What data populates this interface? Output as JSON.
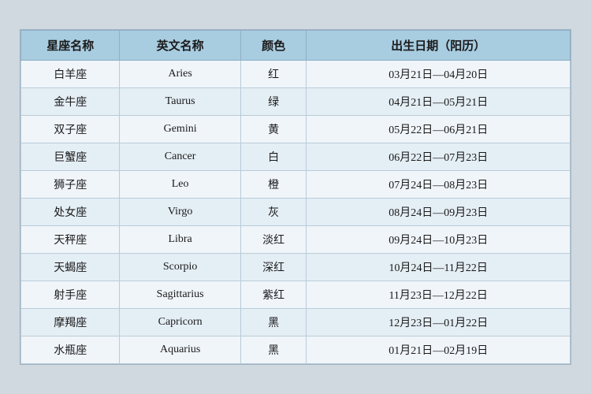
{
  "table": {
    "headers": [
      "星座名称",
      "英文名称",
      "颜色",
      "出生日期（阳历）"
    ],
    "rows": [
      {
        "zh": "白羊座",
        "en": "Aries",
        "color": "红",
        "date": "03月21日—04月20日"
      },
      {
        "zh": "金牛座",
        "en": "Taurus",
        "color": "绿",
        "date": "04月21日—05月21日"
      },
      {
        "zh": "双子座",
        "en": "Gemini",
        "color": "黄",
        "date": "05月22日—06月21日"
      },
      {
        "zh": "巨蟹座",
        "en": "Cancer",
        "color": "白",
        "date": "06月22日—07月23日"
      },
      {
        "zh": "狮子座",
        "en": "Leo",
        "color": "橙",
        "date": "07月24日—08月23日"
      },
      {
        "zh": "处女座",
        "en": "Virgo",
        "color": "灰",
        "date": "08月24日—09月23日"
      },
      {
        "zh": "天秤座",
        "en": "Libra",
        "color": "淡红",
        "date": "09月24日—10月23日"
      },
      {
        "zh": "天蝎座",
        "en": "Scorpio",
        "color": "深红",
        "date": "10月24日—11月22日"
      },
      {
        "zh": "射手座",
        "en": "Sagittarius",
        "color": "紫红",
        "date": "11月23日—12月22日"
      },
      {
        "zh": "摩羯座",
        "en": "Capricorn",
        "color": "黑",
        "date": "12月23日—01月22日"
      },
      {
        "zh": "水瓶座",
        "en": "Aquarius",
        "color": "黑",
        "date": "01月21日—02月19日"
      }
    ]
  }
}
